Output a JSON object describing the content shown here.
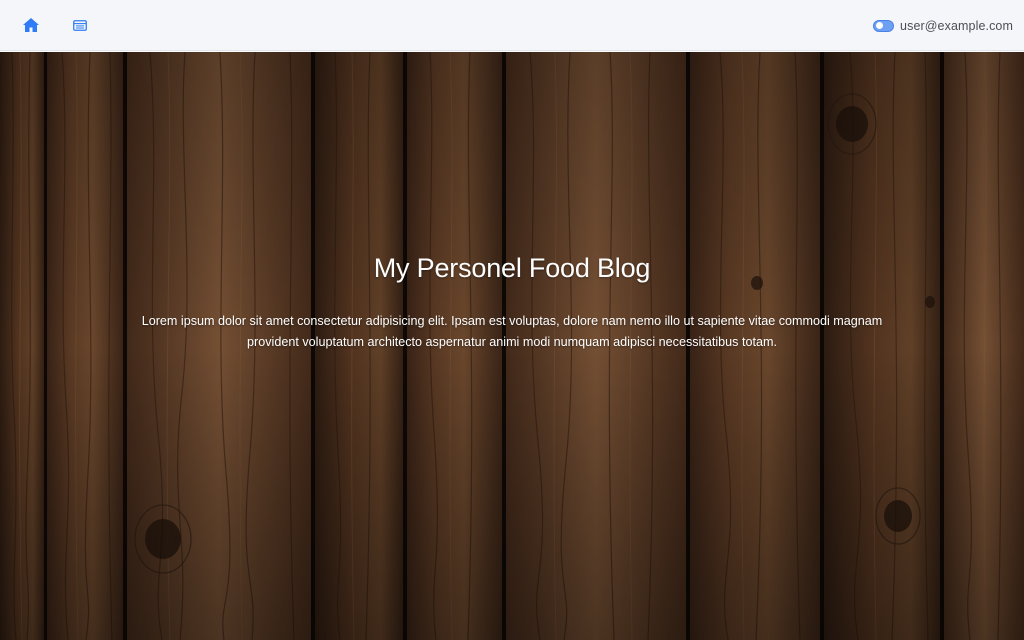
{
  "nav": {
    "home_icon": "home-icon",
    "list_icon": "list-icon"
  },
  "user": {
    "email": "user@example.com",
    "toggle_on": true
  },
  "hero": {
    "title": "My Personel Food Blog",
    "text": "Lorem ipsum dolor sit amet consectetur adipisicing elit. Ipsam est voluptas, dolore nam nemo illo ut sapiente vitae commodi magnam provident voluptatum architecto aspernatur animi modi numquam adipisci necessitatibus totam."
  },
  "colors": {
    "accent": "#2f7cf6",
    "topbar_bg": "#f5f6f9",
    "wood_dark": "#2a1a10",
    "wood_mid": "#5a3a24",
    "wood_light": "#7a5236"
  }
}
